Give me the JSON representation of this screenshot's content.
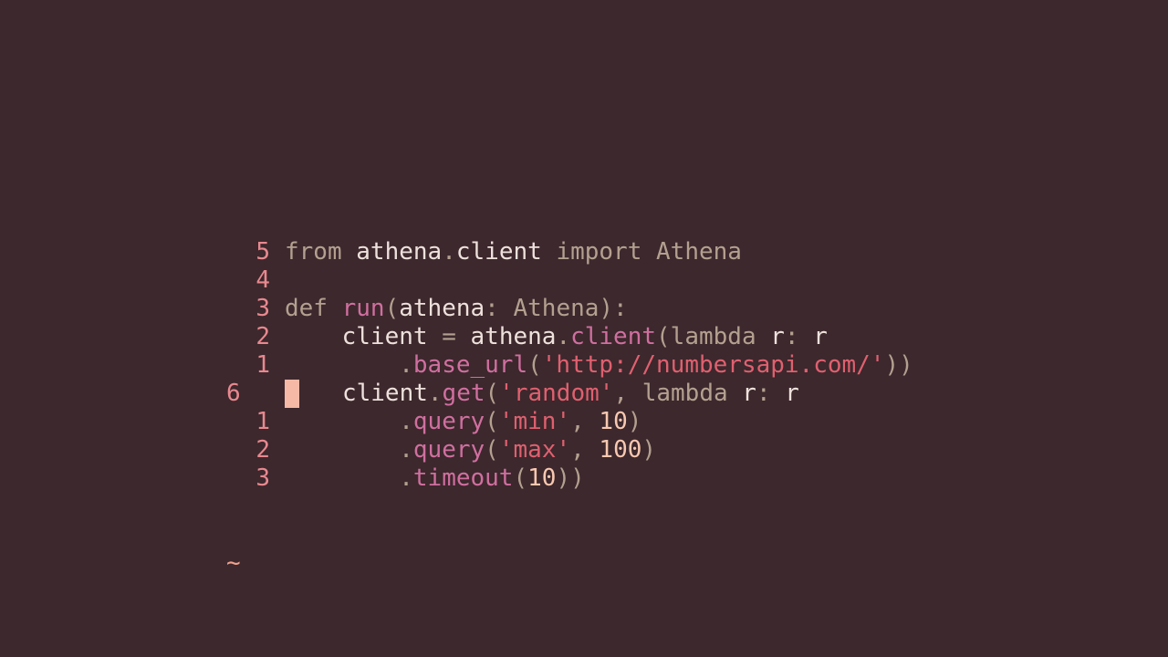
{
  "editor": {
    "lines": [
      {
        "num": "5",
        "current": false,
        "tokens": [
          {
            "t": "from",
            "c": "kw"
          },
          {
            "t": " ",
            "c": "id"
          },
          {
            "t": "athena",
            "c": "id"
          },
          {
            "t": ".",
            "c": "pun"
          },
          {
            "t": "client",
            "c": "id"
          },
          {
            "t": " ",
            "c": "id"
          },
          {
            "t": "import",
            "c": "kw"
          },
          {
            "t": " ",
            "c": "id"
          },
          {
            "t": "Athena",
            "c": "kw"
          }
        ]
      },
      {
        "num": "4",
        "current": false,
        "tokens": []
      },
      {
        "num": "3",
        "current": false,
        "tokens": [
          {
            "t": "def",
            "c": "kw"
          },
          {
            "t": " ",
            "c": "id"
          },
          {
            "t": "run",
            "c": "fn"
          },
          {
            "t": "(",
            "c": "pun"
          },
          {
            "t": "athena",
            "c": "id"
          },
          {
            "t": ": ",
            "c": "pun"
          },
          {
            "t": "Athena",
            "c": "kw"
          },
          {
            "t": "):",
            "c": "pun"
          }
        ]
      },
      {
        "num": "2",
        "current": false,
        "tokens": [
          {
            "t": "    ",
            "c": "id"
          },
          {
            "t": "client",
            "c": "id"
          },
          {
            "t": " = ",
            "c": "pun"
          },
          {
            "t": "athena",
            "c": "id"
          },
          {
            "t": ".",
            "c": "pun"
          },
          {
            "t": "client",
            "c": "fn"
          },
          {
            "t": "(",
            "c": "pun"
          },
          {
            "t": "lambda",
            "c": "kw"
          },
          {
            "t": " ",
            "c": "id"
          },
          {
            "t": "r",
            "c": "id"
          },
          {
            "t": ": ",
            "c": "pun"
          },
          {
            "t": "r",
            "c": "id"
          }
        ]
      },
      {
        "num": "1",
        "current": false,
        "tokens": [
          {
            "t": "        ",
            "c": "id"
          },
          {
            "t": ".",
            "c": "pun"
          },
          {
            "t": "base_url",
            "c": "fn"
          },
          {
            "t": "(",
            "c": "pun"
          },
          {
            "t": "'http://numbersapi.com/'",
            "c": "str"
          },
          {
            "t": "))",
            "c": "pun"
          }
        ]
      },
      {
        "num": "6",
        "current": true,
        "tokens": [
          {
            "t": "   ",
            "c": "id"
          },
          {
            "t": "client",
            "c": "id"
          },
          {
            "t": ".",
            "c": "pun"
          },
          {
            "t": "get",
            "c": "fn"
          },
          {
            "t": "(",
            "c": "pun"
          },
          {
            "t": "'random'",
            "c": "str"
          },
          {
            "t": ", ",
            "c": "pun"
          },
          {
            "t": "lambda",
            "c": "kw"
          },
          {
            "t": " ",
            "c": "id"
          },
          {
            "t": "r",
            "c": "id"
          },
          {
            "t": ": ",
            "c": "pun"
          },
          {
            "t": "r",
            "c": "id"
          }
        ]
      },
      {
        "num": "1",
        "current": false,
        "tokens": [
          {
            "t": "        ",
            "c": "id"
          },
          {
            "t": ".",
            "c": "pun"
          },
          {
            "t": "query",
            "c": "fn"
          },
          {
            "t": "(",
            "c": "pun"
          },
          {
            "t": "'min'",
            "c": "str"
          },
          {
            "t": ", ",
            "c": "pun"
          },
          {
            "t": "10",
            "c": "num"
          },
          {
            "t": ")",
            "c": "pun"
          }
        ]
      },
      {
        "num": "2",
        "current": false,
        "tokens": [
          {
            "t": "        ",
            "c": "id"
          },
          {
            "t": ".",
            "c": "pun"
          },
          {
            "t": "query",
            "c": "fn"
          },
          {
            "t": "(",
            "c": "pun"
          },
          {
            "t": "'max'",
            "c": "str"
          },
          {
            "t": ", ",
            "c": "pun"
          },
          {
            "t": "100",
            "c": "num"
          },
          {
            "t": ")",
            "c": "pun"
          }
        ]
      },
      {
        "num": "3",
        "current": false,
        "tokens": [
          {
            "t": "        ",
            "c": "id"
          },
          {
            "t": ".",
            "c": "pun"
          },
          {
            "t": "timeout",
            "c": "fn"
          },
          {
            "t": "(",
            "c": "pun"
          },
          {
            "t": "10",
            "c": "num"
          },
          {
            "t": "))",
            "c": "pun"
          }
        ]
      }
    ],
    "end_marker": "~"
  },
  "colors": {
    "background": "#3c282d",
    "line_number": "#e8888f",
    "keyword": "#b4a08f",
    "function": "#d06f9f",
    "string": "#e0606f",
    "number": "#f8c8b0",
    "identifier": "#eee1dc",
    "cursor": "#f5b9a6",
    "end_marker": "#f0a28d"
  }
}
